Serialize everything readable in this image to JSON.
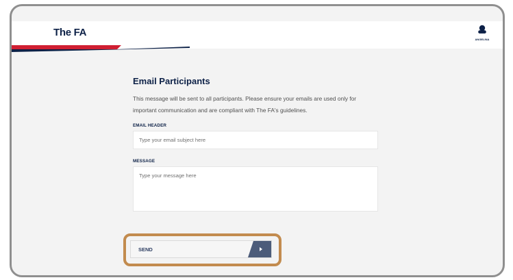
{
  "brand": {
    "name": "The FA"
  },
  "user": {
    "name": "ANGELINA"
  },
  "form": {
    "title": "Email Participants",
    "description": "This message will be sent to all participants. Please ensure your emails are used only for important communication and are compliant with The FA's guidelines.",
    "email_header_label": "EMAIL HEADER",
    "email_header_placeholder": "Type your email subject here",
    "message_label": "MESSAGE",
    "message_placeholder": "Type your message here",
    "send_label": "SEND"
  },
  "colors": {
    "navy": "#0d2147",
    "red": "#d01f32",
    "highlight": "#c28b4e",
    "button_arrow": "#4c5c7a"
  },
  "icons": {
    "user": "user-icon",
    "send_arrow": "chevron-right-icon"
  }
}
